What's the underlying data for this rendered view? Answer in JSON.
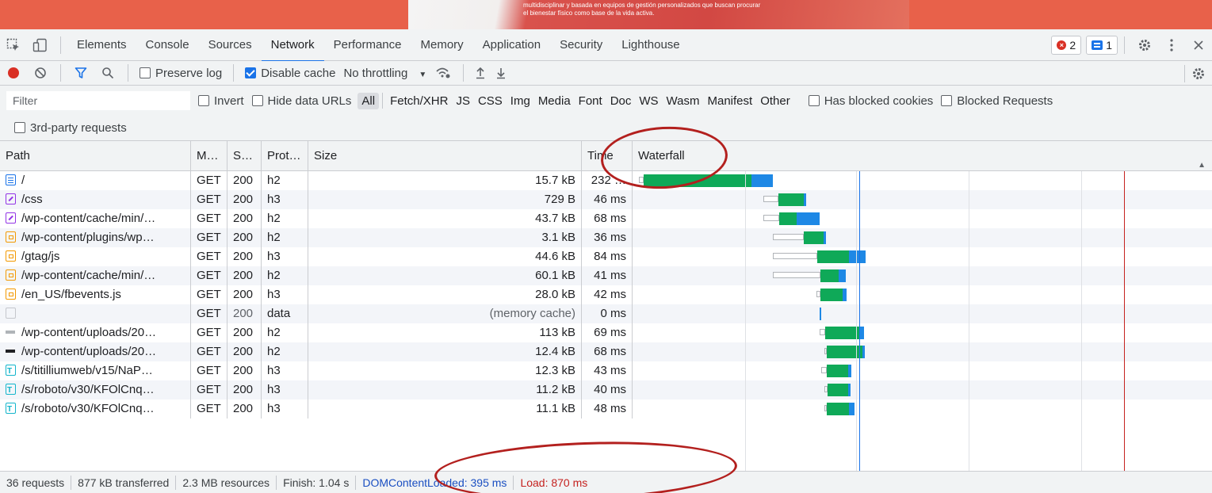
{
  "page_banner": {
    "text": "multidisciplinar y basada en equipos de gestión personalizados que buscan procurar el bienestar físico como base de la vida activa."
  },
  "devtools": {
    "tabs": [
      "Elements",
      "Console",
      "Sources",
      "Network",
      "Performance",
      "Memory",
      "Application",
      "Security",
      "Lighthouse"
    ],
    "active_tab": "Network",
    "error_count": "2",
    "message_count": "1",
    "icons": {
      "inspect": "inspect-element-icon",
      "device": "device-toolbar-icon",
      "settings": "gear-icon",
      "more": "kebab-menu-icon",
      "close": "close-icon"
    }
  },
  "network_toolbar": {
    "preserve_log_label": "Preserve log",
    "preserve_log_checked": false,
    "disable_cache_label": "Disable cache",
    "disable_cache_checked": true,
    "throttling_value": "No throttling",
    "icons": [
      "record-icon",
      "clear-icon",
      "filter-icon",
      "search-icon",
      "network-conditions-icon",
      "import-icon",
      "export-icon",
      "gear-icon"
    ]
  },
  "filter_bar": {
    "placeholder": "Filter",
    "invert_label": "Invert",
    "hide_data_urls_label": "Hide data URLs",
    "types": [
      "All",
      "Fetch/XHR",
      "JS",
      "CSS",
      "Img",
      "Media",
      "Font",
      "Doc",
      "WS",
      "Wasm",
      "Manifest",
      "Other"
    ],
    "active_type": "All",
    "has_blocked_cookies_label": "Has blocked cookies",
    "blocked_requests_label": "Blocked Requests",
    "third_party_label": "3rd-party requests"
  },
  "table": {
    "columns": {
      "path": "Path",
      "method": "M…",
      "status": "S…",
      "protocol": "Prot…",
      "size": "Size",
      "time": "Time",
      "waterfall": "Waterfall"
    },
    "rows": [
      {
        "icon": "doc",
        "path": "/",
        "method": "GET",
        "status": "200",
        "protocol": "h2",
        "size": "15.7 kB",
        "time": "232 …",
        "wf": {
          "wait": [
            806,
            812
          ],
          "green": [
            812,
            948
          ],
          "blue": [
            948,
            975
          ]
        }
      },
      {
        "icon": "css",
        "path": "/css",
        "method": "GET",
        "status": "200",
        "protocol": "h3",
        "size": "729 B",
        "time": "46 ms",
        "wf": {
          "wait": [
            963,
            982
          ],
          "green": [
            982,
            1014
          ],
          "blue": [
            1014,
            1017
          ]
        }
      },
      {
        "icon": "css",
        "path": "/wp-content/cache/min/…",
        "method": "GET",
        "status": "200",
        "protocol": "h2",
        "size": "43.7 kB",
        "time": "68 ms",
        "wf": {
          "wait": [
            963,
            983
          ],
          "green": [
            983,
            1005
          ],
          "blue": [
            1005,
            1034
          ]
        }
      },
      {
        "icon": "js",
        "path": "/wp-content/plugins/wp…",
        "method": "GET",
        "status": "200",
        "protocol": "h2",
        "size": "3.1 kB",
        "time": "36 ms",
        "wf": {
          "wait": [
            975,
            1014
          ],
          "green": [
            1014,
            1039
          ],
          "blue": [
            1039,
            1042
          ]
        }
      },
      {
        "icon": "js",
        "path": "/gtag/js",
        "method": "GET",
        "status": "200",
        "protocol": "h3",
        "size": "44.6 kB",
        "time": "84 ms",
        "wf": {
          "wait": [
            975,
            1031
          ],
          "green": [
            1031,
            1071
          ],
          "blue": [
            1071,
            1092
          ]
        }
      },
      {
        "icon": "js",
        "path": "/wp-content/cache/min/…",
        "method": "GET",
        "status": "200",
        "protocol": "h2",
        "size": "60.1 kB",
        "time": "41 ms",
        "wf": {
          "wait": [
            975,
            1035
          ],
          "green": [
            1035,
            1058
          ],
          "blue": [
            1058,
            1067
          ]
        }
      },
      {
        "icon": "js",
        "path": "/en_US/fbevents.js",
        "method": "GET",
        "status": "200",
        "protocol": "h3",
        "size": "28.0 kB",
        "time": "42 ms",
        "wf": {
          "wait": [
            1030,
            1035
          ],
          "green": [
            1035,
            1063
          ],
          "blue": [
            1063,
            1068
          ]
        }
      },
      {
        "icon": "blank",
        "path": "",
        "method": "GET",
        "status": "200",
        "protocol": "data",
        "size": "(memory cache)",
        "time": "0 ms",
        "wf": {
          "wait": [
            0,
            0
          ],
          "green": [
            0,
            0
          ],
          "blue": [
            1034,
            1036
          ]
        }
      },
      {
        "icon": "img1",
        "path": "/wp-content/uploads/20…",
        "method": "GET",
        "status": "200",
        "protocol": "h2",
        "size": "113 kB",
        "time": "69 ms",
        "wf": {
          "wait": [
            1034,
            1041
          ],
          "green": [
            1041,
            1084
          ],
          "blue": [
            1084,
            1090
          ]
        }
      },
      {
        "icon": "img2",
        "path": "/wp-content/uploads/20…",
        "method": "GET",
        "status": "200",
        "protocol": "h2",
        "size": "12.4 kB",
        "time": "68 ms",
        "wf": {
          "wait": [
            1040,
            1043
          ],
          "green": [
            1043,
            1088
          ],
          "blue": [
            1088,
            1091
          ]
        }
      },
      {
        "icon": "font",
        "path": "/s/titilliumweb/v15/NaP…",
        "method": "GET",
        "status": "200",
        "protocol": "h3",
        "size": "12.3 kB",
        "time": "43 ms",
        "wf": {
          "wait": [
            1036,
            1043
          ],
          "green": [
            1043,
            1070
          ],
          "blue": [
            1070,
            1074
          ]
        }
      },
      {
        "icon": "font",
        "path": "/s/roboto/v30/KFOlCnq…",
        "method": "GET",
        "status": "200",
        "protocol": "h3",
        "size": "11.2 kB",
        "time": "40 ms",
        "wf": {
          "wait": [
            1040,
            1044
          ],
          "green": [
            1044,
            1070
          ],
          "blue": [
            1070,
            1073
          ]
        }
      },
      {
        "icon": "font",
        "path": "/s/roboto/v30/KFOlCnq…",
        "method": "GET",
        "status": "200",
        "protocol": "h3",
        "size": "11.1 kB",
        "time": "48 ms",
        "wf": {
          "wait": [
            1040,
            1043
          ],
          "green": [
            1043,
            1071
          ],
          "blue": [
            1071,
            1078
          ]
        }
      }
    ]
  },
  "status_bar": {
    "requests": "36 requests",
    "transferred": "877 kB transferred",
    "resources": "2.3 MB resources",
    "finish": "Finish: 1.04 s",
    "dom_content_loaded": "DOMContentLoaded: 395 ms",
    "load": "Load: 870 ms"
  },
  "colors": {
    "dom_content_loaded_line": "#1a73e8",
    "load_line": "#c5221f",
    "annotation": "#b3201e"
  }
}
